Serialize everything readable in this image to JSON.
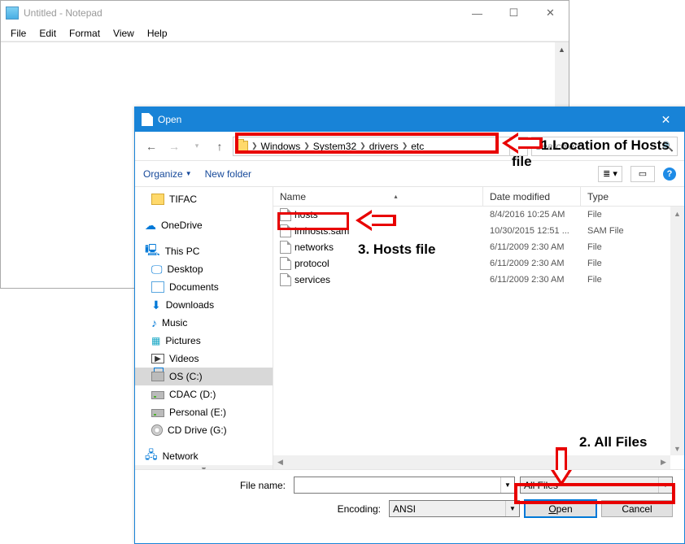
{
  "notepad": {
    "title": "Untitled - Notepad",
    "menu": [
      "File",
      "Edit",
      "Format",
      "View",
      "Help"
    ]
  },
  "dialog": {
    "title": "Open",
    "breadcrumb": [
      "Windows",
      "System32",
      "drivers",
      "etc"
    ],
    "search_placeholder": "Search etc",
    "toolbar": {
      "organize": "Organize",
      "newfolder": "New folder"
    },
    "sidebar": {
      "tifac": "TIFAC",
      "onedrive": "OneDrive",
      "thispc": "This PC",
      "desktop": "Desktop",
      "documents": "Documents",
      "downloads": "Downloads",
      "music": "Music",
      "pictures": "Pictures",
      "videos": "Videos",
      "osc": "OS (C:)",
      "cdac": "CDAC (D:)",
      "personal": "Personal (E:)",
      "cddrive": "CD Drive (G:)",
      "network": "Network"
    },
    "columns": {
      "name": "Name",
      "date": "Date modified",
      "type": "Type"
    },
    "files": [
      {
        "name": "hosts",
        "date": "8/4/2016 10:25 AM",
        "type": "File"
      },
      {
        "name": "lmhosts.sam",
        "date": "10/30/2015 12:51 ...",
        "type": "SAM File"
      },
      {
        "name": "networks",
        "date": "6/11/2009 2:30 AM",
        "type": "File"
      },
      {
        "name": "protocol",
        "date": "6/11/2009 2:30 AM",
        "type": "File"
      },
      {
        "name": "services",
        "date": "6/11/2009 2:30 AM",
        "type": "File"
      }
    ],
    "footer": {
      "filename_label": "File name:",
      "filename_value": "",
      "filter_value": "All Files",
      "encoding_label": "Encoding:",
      "encoding_value": "ANSI",
      "open": "Open",
      "cancel": "Cancel"
    }
  },
  "annotations": {
    "a1_line1": "1.Location of Hosts",
    "a1_line2": "file",
    "a2": "2. All Files",
    "a3": "3. Hosts file"
  }
}
